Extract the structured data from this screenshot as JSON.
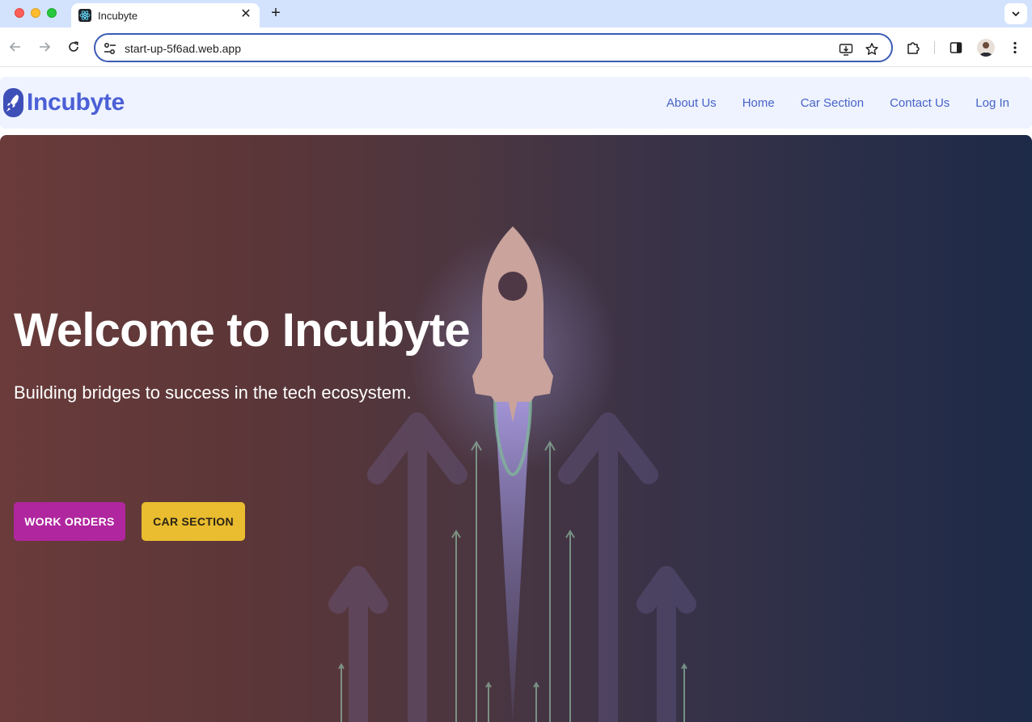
{
  "browser": {
    "tab_title": "Incubyte",
    "url": "start-up-5f6ad.web.app",
    "icons": {
      "favicon": "react-atom-icon",
      "back": "back-arrow-icon",
      "forward": "forward-arrow-icon",
      "reload": "reload-icon",
      "site_info": "tune-icon",
      "install": "install-app-icon",
      "bookmark": "star-icon",
      "extensions": "puzzle-icon",
      "side_panel": "side-panel-icon",
      "menu": "kebab-menu-icon"
    }
  },
  "site": {
    "brand": "Incubyte",
    "nav": [
      "About Us",
      "Home",
      "Car Section",
      "Contact Us",
      "Log In"
    ]
  },
  "hero": {
    "title": "Welcome to Incubyte",
    "subtitle": "Building bridges to success in the tech ecosystem.",
    "primary_button": "WORK ORDERS",
    "secondary_button": "CAR SECTION"
  },
  "colors": {
    "brand": "#4b5fd6",
    "nav_link": "#4763c7",
    "nav_bg": "#eef3ff",
    "primary_button": "#b0269f",
    "secondary_button": "#e9bd2f"
  }
}
